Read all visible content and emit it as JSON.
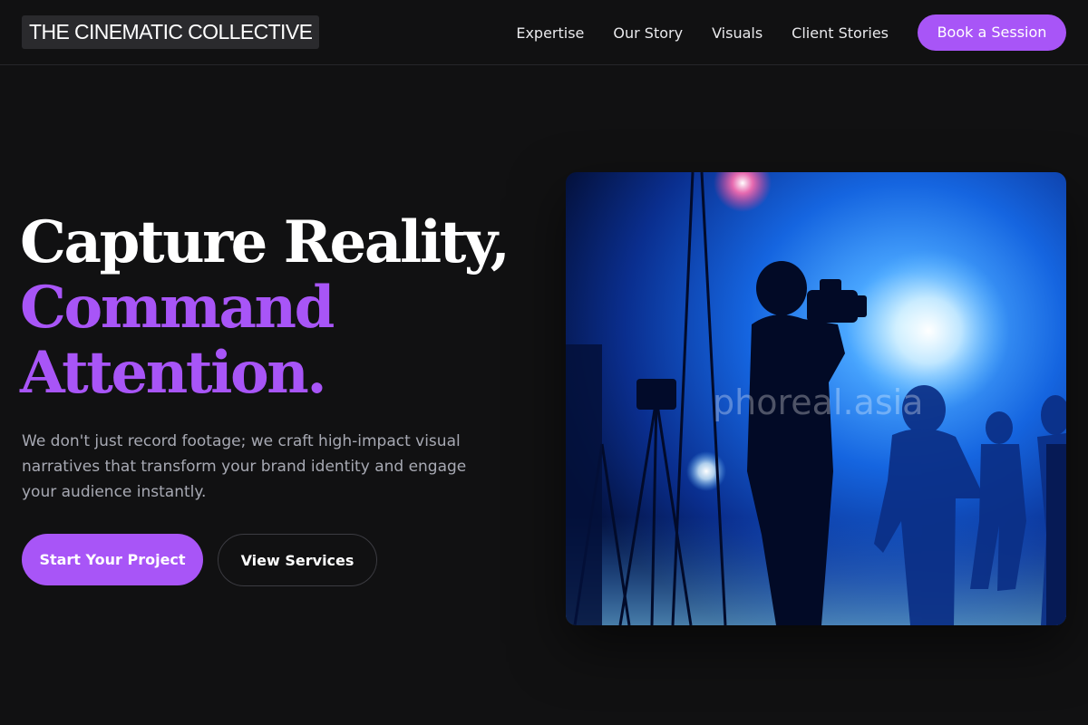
{
  "header": {
    "logo": "THE CINEMATIC COLLECTIVE",
    "nav": [
      "Expertise",
      "Our Story",
      "Visuals",
      "Client Stories"
    ],
    "cta_label": "Book a Session"
  },
  "hero": {
    "title_line1": "Capture Reality,",
    "title_line2": "Command",
    "title_line3": "Attention.",
    "description": "We don't just record footage; we craft high-impact visual narratives that transform your brand identity and engage your audience instantly.",
    "primary_button": "Start Your Project",
    "secondary_button": "View Services",
    "image_watermark": "phoreal.asia"
  },
  "colors": {
    "background": "#111112",
    "accent": "#a855f7",
    "text_muted": "#a7a9b3"
  }
}
